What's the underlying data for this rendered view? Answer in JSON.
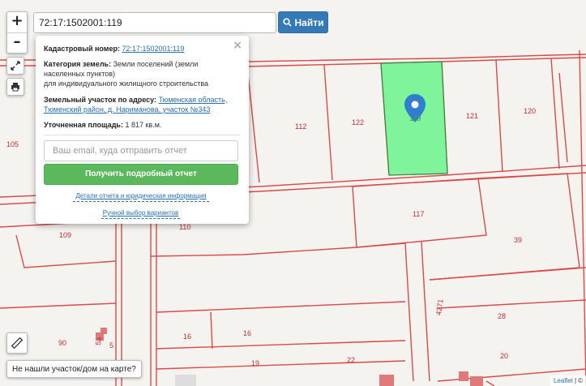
{
  "search": {
    "value": "72:17:1502001:119",
    "button_label": "Найти"
  },
  "controls": {
    "zoom_in": "+",
    "zoom_out": "–"
  },
  "popup": {
    "cadastral_label": "Кадастровый номер:",
    "cadastral_value": "72:17:1502001:119",
    "category_label": "Категория земель:",
    "category_value": "Земли поселений (земли населенных пунктов)",
    "usage_value": "для индивидуального жилищного строительства",
    "address_label": "Земельный участок по адресу:",
    "address_value": "Тюменская область, Тюменский район, д. Нариманова, участок №343",
    "area_label": "Уточненная площадь:",
    "area_value": "1 817 кв.м.",
    "email_placeholder": "Ваш email, куда отправить отчет",
    "report_button": "Получить подробный отчет",
    "details_link": "Детали отчета и юридическая информация",
    "manual_link": "Ручной выбор вариантов"
  },
  "map": {
    "plot_numbers": {
      "p105": "105",
      "p112": "112",
      "p122": "122",
      "p119": "119",
      "p121": "121",
      "p120": "120",
      "p109": "109",
      "p110": "110",
      "p117": "117",
      "p39": "39",
      "p28": "28",
      "p16a": "16",
      "p16b": "16",
      "p90": "90",
      "p5": "5",
      "p19": "19",
      "p22": "22",
      "p20": "20",
      "p4271": "4271",
      "p5a": "5а"
    },
    "highlight_color": "#80f49a",
    "boundary_color": "#d94a4a",
    "marker_color": "#2e7fd0"
  },
  "not_found": "Не нашли участок/дом на карте?",
  "attribution": {
    "brand": "Leaflet",
    "separator": "|",
    "extra": "©"
  }
}
